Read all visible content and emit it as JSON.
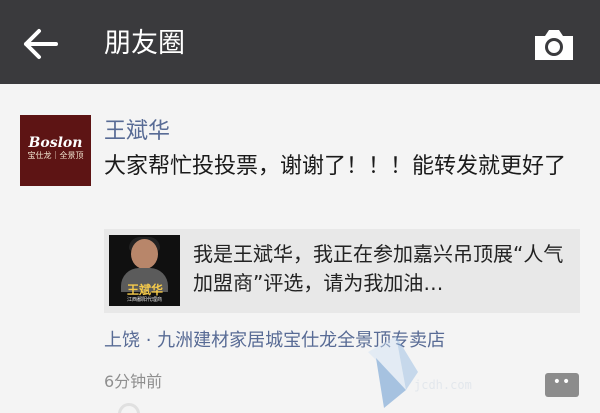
{
  "header": {
    "title": "朋友圈",
    "back_icon": "back-arrow-icon",
    "camera_icon": "camera-icon"
  },
  "post": {
    "avatar": {
      "brand": "Boslon",
      "brand_sub": "宝仕龙｜全景顶"
    },
    "username": "王斌华",
    "text": "大家帮忙投投票，谢谢了！！！能转发就更好了",
    "shared_link": {
      "title": "我是王斌华，我正在参加嘉兴吊顶展“人气加盟商”评选，请为我加油…",
      "thumbnail_signature": "王斌华",
      "thumbnail_caption": "江西鄱阳代理商"
    },
    "location": "上饶 · 九洲建材家居城宝仕龙全景顶专卖店",
    "time": "6分钟前",
    "comment_icon": "comment-dots-icon"
  },
  "watermark": {
    "text": "jcdh.com"
  },
  "colors": {
    "topbar": "#3a3a3d",
    "link_blue": "#586b95",
    "avatar_red": "#5d1414",
    "background": "#f4f4f4"
  }
}
